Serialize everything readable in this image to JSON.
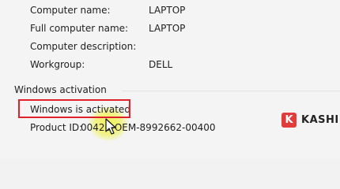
{
  "computer": {
    "rows": [
      {
        "label": "Computer name:",
        "value": "LAPTOP"
      },
      {
        "label": "Full computer name:",
        "value": "LAPTOP"
      },
      {
        "label": "Computer description:",
        "value": ""
      },
      {
        "label": "Workgroup:",
        "value": "DELL"
      }
    ]
  },
  "activation": {
    "section_title": "Windows activation",
    "status": "Windows is activated",
    "product_id_label": "Product ID:",
    "product_id_value": "00426-OEM-8992662-00400"
  },
  "watermark": {
    "badge": "K",
    "text": "KASHI"
  },
  "colors": {
    "highlight_border": "#e0202a",
    "cursor_highlight": "#f0f03c",
    "brand_red": "#e23b3b"
  },
  "icons": {
    "cursor": "mouse-pointer-icon"
  }
}
